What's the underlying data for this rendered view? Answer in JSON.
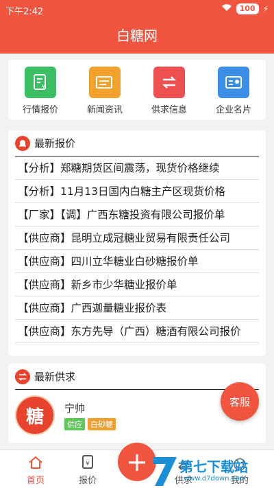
{
  "status": {
    "time": "下午2:42",
    "battery": "100"
  },
  "header": {
    "title": "白糖网"
  },
  "quick_links": [
    {
      "label": "行情报价",
      "icon": "price-doc-icon",
      "color": "#3cbf63"
    },
    {
      "label": "新闻资讯",
      "icon": "news-icon",
      "color": "#f2a22a"
    },
    {
      "label": "供求信息",
      "icon": "exchange-icon",
      "color": "#ee4f4f"
    },
    {
      "label": "企业名片",
      "icon": "business-card-icon",
      "color": "#3b8ee6"
    }
  ],
  "latest_prices": {
    "title": "最新报价",
    "items": [
      "【分析】郑糖期货区间震荡，现货价格继续",
      "【分析】11月13日国内白糖主产区现货价格",
      "【厂家】【调】广西东糖投资有限公司报价单",
      "【供应商】昆明立成冠糖业贸易有限责任公司",
      "【供应商】四川立华糖业白砂糖报价单",
      "【供应商】新乡市少华糖业报价单",
      "【供应商】广西迦量糖业报价表",
      "【供应商】东方先导（广西）糖酒有限公司报价"
    ]
  },
  "latest_supply": {
    "title": "最新供求",
    "avatar_text": "糖",
    "name": "宁帅",
    "tags": [
      "供应",
      "白砂糖"
    ]
  },
  "kefu_label": "客服",
  "tabs": [
    {
      "label": "首页",
      "icon": "home-icon"
    },
    {
      "label": "报价",
      "icon": "price-icon"
    },
    {
      "label": "供求",
      "icon": "supply-icon"
    },
    {
      "label": "我的",
      "icon": "user-icon"
    }
  ],
  "publish_label": "+",
  "watermark": {
    "text": "第七下载站",
    "url": "www.d7down.com"
  }
}
